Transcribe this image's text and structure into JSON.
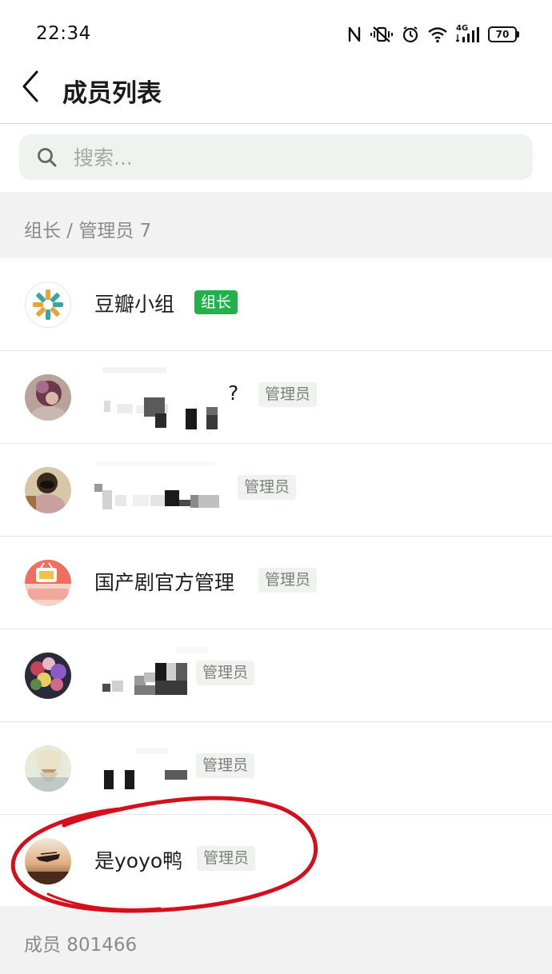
{
  "status_bar": {
    "time": "22:34",
    "network": "4G",
    "battery": "70"
  },
  "header": {
    "back_icon": "chevron-left-icon",
    "title": "成员列表"
  },
  "search": {
    "placeholder": "搜索..."
  },
  "sections": {
    "admins_header": "组长 / 管理员 7",
    "members_header": "成员 801466"
  },
  "members": [
    {
      "name": "豆瓣小组",
      "role": "组长",
      "role_type": "owner"
    },
    {
      "name": "?",
      "role": "管理员",
      "role_type": "admin",
      "name_redacted": true
    },
    {
      "name": "",
      "role": "管理员",
      "role_type": "admin",
      "name_redacted": true
    },
    {
      "name": "国产剧官方管理",
      "role": "管理员",
      "role_type": "admin"
    },
    {
      "name": "",
      "role": "管理员",
      "role_type": "admin",
      "name_redacted": true
    },
    {
      "name": "",
      "role": "管理员",
      "role_type": "admin",
      "name_redacted": true
    },
    {
      "name": "是yoyo鸭",
      "role": "管理员",
      "role_type": "admin",
      "highlighted": true
    }
  ],
  "colors": {
    "owner_badge": "#23b14d",
    "admin_badge_bg": "#f0f2f0",
    "annotation": "#d4101c"
  }
}
